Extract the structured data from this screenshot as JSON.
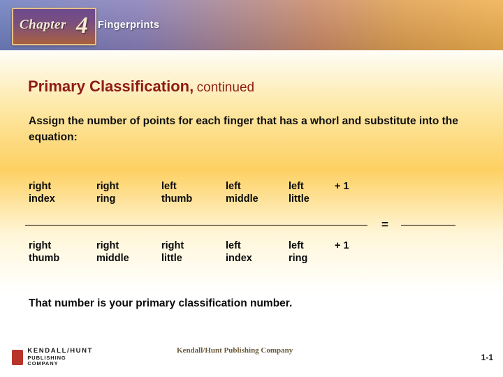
{
  "banner": {
    "chapter_word": "Chapter",
    "chapter_number": "4",
    "title": "Fingerprints"
  },
  "headline": {
    "main": "Primary Classification,",
    "continued": "continued"
  },
  "intro": "Assign the number of points for each finger that has a whorl and substitute into the equation:",
  "equation": {
    "numerator": [
      "right\nindex",
      "right\nring",
      "left\nthumb",
      "left\nmiddle",
      "left\nlittle"
    ],
    "numerator_plus": "+ 1",
    "denominator": [
      "right\nthumb",
      "right\nmiddle",
      "right\nlittle",
      "left\nindex",
      "left\nring"
    ],
    "denominator_plus": "+ 1",
    "equals": "="
  },
  "closing": "That number is your primary classification number.",
  "footer": {
    "publisher": "Kendall/Hunt Publishing Company",
    "logo_line1": "KENDALL/HUNT",
    "logo_line2": "PUBLISHING COMPANY",
    "page_number": "1-1"
  },
  "colors": {
    "headline": "#8e1b17",
    "banner_start": "#6f7fc0",
    "banner_end": "#f0b050",
    "logo_mark": "#b8342b"
  }
}
